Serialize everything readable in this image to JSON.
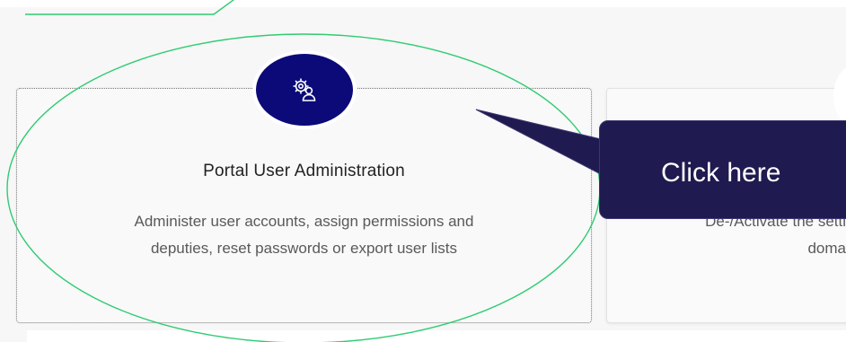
{
  "card_left": {
    "title": "Portal User Administration",
    "description_line1": "Administer user accounts, assign permissions and",
    "description_line2": "deputies, reset passwords or export user lists",
    "icon": "user-settings-icon"
  },
  "card_right": {
    "description_line1": "De-/Activate the setti",
    "description_line2": "doma"
  },
  "callout": {
    "text": "Click here"
  },
  "colors": {
    "icon_bg": "#0b0a78",
    "callout_bg": "#1f1a4f",
    "highlight_ellipse": "#2ecc71"
  }
}
